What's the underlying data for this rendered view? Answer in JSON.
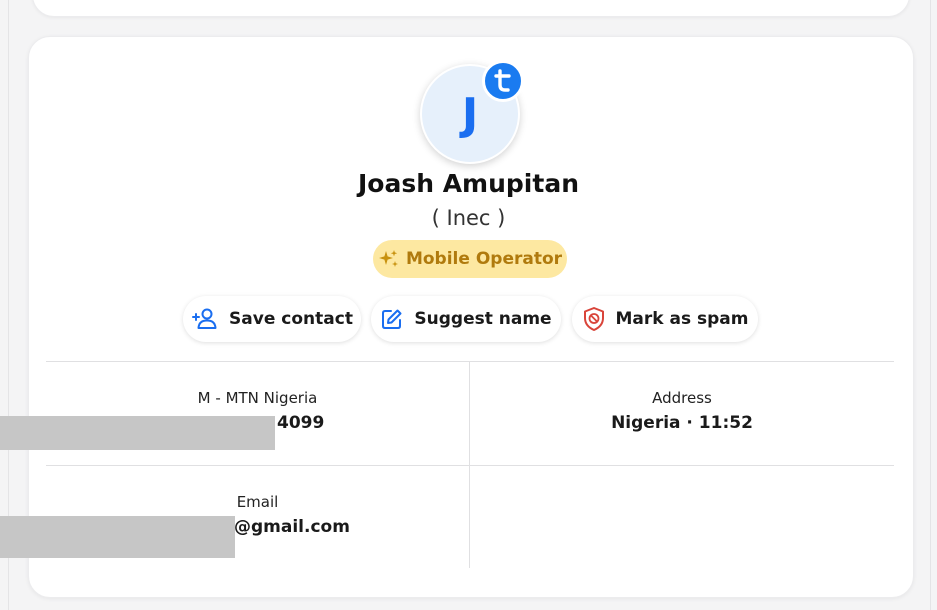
{
  "contact": {
    "initial": "J",
    "name": "Joash Amupitan",
    "subname": "( Inec )",
    "tag_label": "Mobile Operator"
  },
  "brand_badge_icon": "truecaller-logo-icon",
  "actions": {
    "save_label": "Save contact",
    "suggest_label": "Suggest name",
    "spam_label": "Mark as spam"
  },
  "details": {
    "phone": {
      "label": "M - MTN Nigeria",
      "value_suffix": "4099"
    },
    "address": {
      "label": "Address",
      "value": "Nigeria · 11:52"
    },
    "email": {
      "label": "Email",
      "value_suffix": "@gmail.com"
    }
  },
  "colors": {
    "accent_blue": "#1a6ef0",
    "tag_bg": "#fde8a1",
    "tag_text": "#b07a0d",
    "spam_red": "#d9443a"
  }
}
